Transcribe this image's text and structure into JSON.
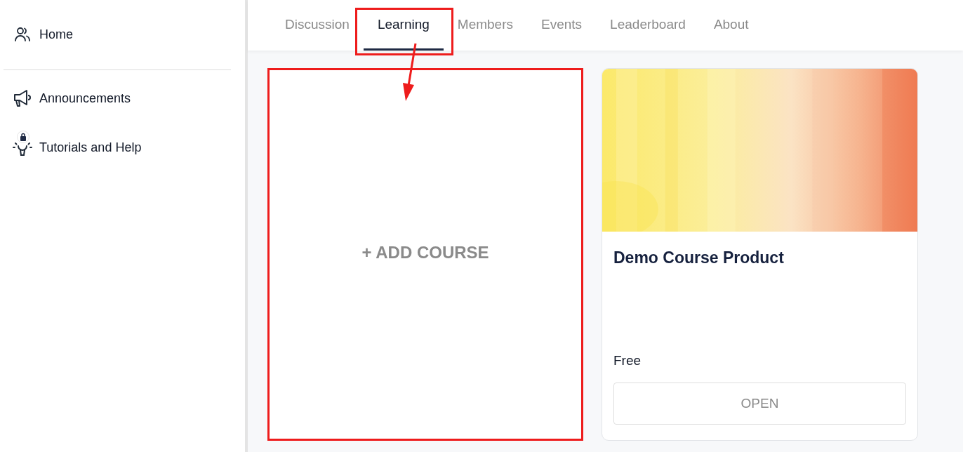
{
  "sidebar": {
    "sections": [
      {
        "items": [
          {
            "kind": "people",
            "label": "Home",
            "locked": false
          }
        ]
      },
      {
        "items": [
          {
            "kind": "megaphone",
            "label": "Announcements",
            "locked": false
          },
          {
            "kind": "lightbulb",
            "label": "Tutorials and Help",
            "locked": true
          }
        ]
      }
    ]
  },
  "tabs": [
    {
      "label": "Discussion",
      "selected": false,
      "highlighted": false
    },
    {
      "label": "Learning",
      "selected": true,
      "highlighted": true
    },
    {
      "label": "Members",
      "selected": false,
      "highlighted": false
    },
    {
      "label": "Events",
      "selected": false,
      "highlighted": false
    },
    {
      "label": "Leaderboard",
      "selected": false,
      "highlighted": false
    },
    {
      "label": "About",
      "selected": false,
      "highlighted": false
    }
  ],
  "cards": [
    {
      "kind": "add",
      "label": "+ ADD COURSE",
      "highlighted": true
    },
    {
      "kind": "course",
      "title": "Demo Course Product",
      "price": "Free",
      "button": "OPEN",
      "highlighted": false
    }
  ],
  "annotation_arrow": true
}
